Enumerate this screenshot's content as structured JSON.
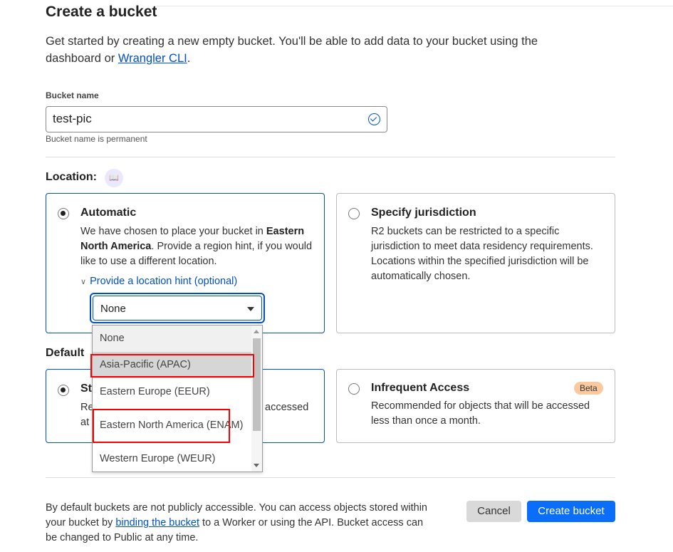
{
  "title": "Create a bucket",
  "intro": {
    "text": "Get started by creating a new empty bucket. You'll be able to add data to your bucket using the dashboard or ",
    "link": "Wrangler CLI",
    "end": "."
  },
  "bucket_name": {
    "label": "Bucket name",
    "value": "test-pic",
    "hint": "Bucket name is permanent",
    "valid_icon": "check-circle-icon"
  },
  "location": {
    "label": "Location:",
    "icon": "book-icon",
    "automatic": {
      "title": "Automatic",
      "text1": "We have chosen to place your bucket in ",
      "bold": "Eastern North America",
      "text2": ". Provide a region hint, if you would like to use a different location.",
      "selected": true
    },
    "hint_link": "Provide a location hint (optional)",
    "select_value": "None",
    "options": [
      "None",
      "Asia-Pacific (APAC)",
      "Eastern Europe (EEUR)",
      "Eastern North America (ENAM)",
      "Western Europe (WEUR)"
    ],
    "highlighted_option": "Asia-Pacific (APAC)",
    "jurisdiction": {
      "title": "Specify jurisdiction",
      "text": "R2 buckets can be restricted to a specific jurisdiction to meet data residency requirements. Locations within the specified jurisdiction will be automatically chosen.",
      "selected": false
    }
  },
  "storage": {
    "label_fragment": "Default",
    "standard": {
      "title_fragment": "St",
      "line1_fragment": "Re",
      "line1_end": "accessed",
      "line2_fragment": "at",
      "selected": true
    },
    "infrequent": {
      "title": "Infrequent Access",
      "badge": "Beta",
      "text": "Recommended for objects that will be accessed less than once a month.",
      "selected": false
    }
  },
  "footer": {
    "text1": "By default buckets are not publicly accessible. You can access objects stored within your bucket by ",
    "link": "binding the bucket",
    "text2": " to a Worker or using the API. Bucket access can be changed to Public at any time."
  },
  "buttons": {
    "cancel": "Cancel",
    "create": "Create bucket"
  },
  "colors": {
    "accent": "#0051c3",
    "primary_button": "#0a6ef8",
    "annotation": "#ff0000",
    "badge": "#fbc99e"
  }
}
